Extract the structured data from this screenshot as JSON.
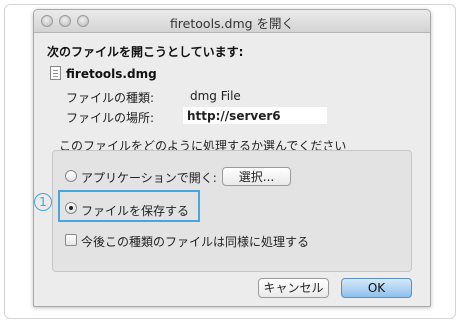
{
  "window": {
    "title": "firetools.dmg を開く"
  },
  "prompt": {
    "heading": "次のファイルを開こうとしています:"
  },
  "file": {
    "name": "firetools.dmg",
    "type_label": "ファイルの種類:",
    "type_value": "dmg File",
    "location_label": "ファイルの場所:",
    "location_value": "http://server6"
  },
  "action": {
    "question": "このファイルをどのように処理するか選んでください",
    "open_with_label": "アプリケーションで開く:",
    "choose_button": "選択...",
    "save_label": "ファイルを保存する",
    "selected_option": "save",
    "remember_label": "今後この種類のファイルは同様に処理する",
    "remember_checked": false
  },
  "callout": {
    "number": "1"
  },
  "buttons": {
    "cancel": "キャンセル",
    "ok": "OK"
  },
  "colors": {
    "highlight": "#47a6e0",
    "ok_button": "#8ec0ec"
  }
}
